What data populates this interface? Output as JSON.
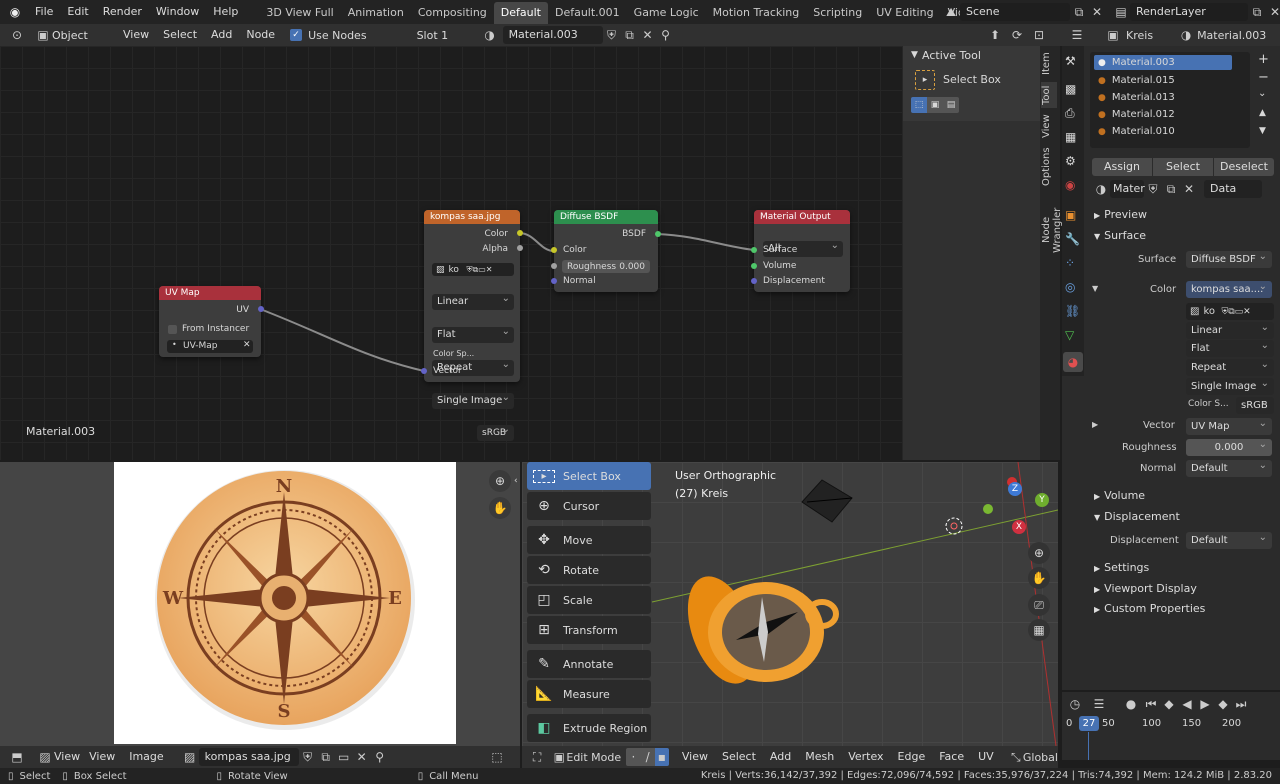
{
  "topbar": {
    "menus": [
      "File",
      "Edit",
      "Render",
      "Window",
      "Help"
    ],
    "workspaces": [
      "3D View Full",
      "Animation",
      "Compositing",
      "Default",
      "Default.001",
      "Game Logic",
      "Motion Tracking",
      "Scripting",
      "UV Editing",
      "Video Editing"
    ],
    "active_workspace": "Default",
    "scene": "Scene",
    "render_layer": "RenderLayer"
  },
  "node_header": {
    "mode": "Object",
    "menus": [
      "View",
      "Select",
      "Add",
      "Node"
    ],
    "use_nodes_label": "Use Nodes",
    "slot": "Slot 1",
    "material": "Material.003"
  },
  "node_editor": {
    "material_label": "Material.003",
    "nodes": {
      "uvmap": {
        "title": "UV Map",
        "output": "UV",
        "from_instancer": "From Instancer",
        "map": "UV-Map"
      },
      "image": {
        "title": "kompas saa.jpg",
        "out_color": "Color",
        "out_alpha": "Alpha",
        "img_name": "ko",
        "interp": "Linear",
        "proj": "Flat",
        "ext": "Repeat",
        "source": "Single Image",
        "cs_label": "Color Sp...",
        "cs_value": "sRGB",
        "in_vector": "Vector"
      },
      "diffuse": {
        "title": "Diffuse BSDF",
        "out": "BSDF",
        "in_color": "Color",
        "roughness_label": "Roughness",
        "roughness": "0.000",
        "normal": "Normal"
      },
      "output": {
        "title": "Material Output",
        "target": "All",
        "surface": "Surface",
        "volume": "Volume",
        "displacement": "Displacement"
      }
    }
  },
  "n_panel": {
    "title": "Active Tool",
    "tool": "Select Box",
    "tabs": [
      "Item",
      "Tool",
      "View",
      "Options",
      "Node Wrangler"
    ]
  },
  "properties": {
    "object": "Kreis",
    "material": "Material.003",
    "slots": [
      "Material.003",
      "Material.015",
      "Material.013",
      "Material.012",
      "Material.010"
    ],
    "assign": "Assign",
    "select": "Select",
    "deselect": "Deselect",
    "mat_short": "Mater",
    "data": "Data",
    "preview": "Preview",
    "surface_section": "Surface",
    "surface_label": "Surface",
    "surface_value": "Diffuse BSDF",
    "color_label": "Color",
    "color_value": "kompas saa....",
    "img_short": "ko",
    "interp": "Linear",
    "proj": "Flat",
    "ext": "Repeat",
    "source": "Single Image",
    "cs_label": "Color S...",
    "cs_value": "sRGB",
    "vector_label": "Vector",
    "vector_value": "UV Map",
    "roughness_label": "Roughness",
    "roughness_value": "0.000",
    "normal_label": "Normal",
    "normal_value": "Default",
    "volume": "Volume",
    "displacement_section": "Displacement",
    "displacement_label": "Displacement",
    "displacement_value": "Default",
    "settings": "Settings",
    "viewport_display": "Viewport Display",
    "custom_properties": "Custom Properties"
  },
  "image_editor": {
    "menus": [
      "View",
      "View",
      "Image"
    ],
    "image": "kompas saa.jpg",
    "letters": [
      "N",
      "E",
      "S",
      "W"
    ]
  },
  "toolbar": {
    "tools": [
      "Select Box",
      "Cursor",
      "Move",
      "Rotate",
      "Scale",
      "Transform",
      "Annotate",
      "Measure",
      "Extrude Region"
    ]
  },
  "viewport": {
    "view_name": "User Orthographic",
    "object_info": "(27) Kreis",
    "mode": "Edit Mode",
    "menus": [
      "View",
      "Select",
      "Add",
      "Mesh",
      "Vertex",
      "Edge",
      "Face",
      "UV"
    ],
    "orientation": "Global",
    "gizmo": {
      "x": "X",
      "y": "Y",
      "z": "Z"
    }
  },
  "timeline": {
    "current_frame": 27,
    "ticks": [
      "0",
      "50",
      "100",
      "150",
      "200"
    ]
  },
  "statusbar": {
    "select": "Select",
    "box_select": "Box Select",
    "rotate_view": "Rotate View",
    "call_menu": "Call Menu",
    "stats": "Kreis | Verts:36,142/37,392 | Edges:72,096/74,592 | Faces:35,976/37,224 | Tris:74,392 | Mem: 124.2 MiB | 2.83.20"
  },
  "colors": {
    "accent": "#4772b3",
    "image_node": "#c0642a",
    "shader_node": "#2d8f4e",
    "output_node": "#a9313c",
    "uv_node": "#a9313c",
    "orange": "#f0a030"
  }
}
